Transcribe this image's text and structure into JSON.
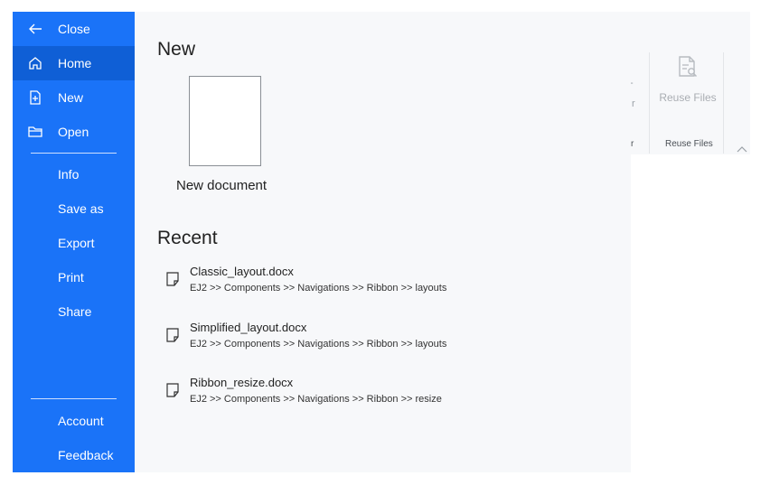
{
  "sidebar": {
    "items": [
      {
        "label": "Close",
        "icon": "arrow-left-icon"
      },
      {
        "label": "Home",
        "icon": "home-icon",
        "active": true
      },
      {
        "label": "New",
        "icon": "new-file-icon"
      },
      {
        "label": "Open",
        "icon": "folder-icon"
      },
      {
        "label": "Info"
      },
      {
        "label": "Save as"
      },
      {
        "label": "Export"
      },
      {
        "label": "Print"
      },
      {
        "label": "Share"
      },
      {
        "label": "Account"
      },
      {
        "label": "Feedback"
      }
    ]
  },
  "main": {
    "new_heading": "New",
    "new_document_label": "New document",
    "recent_heading": "Recent",
    "recent": [
      {
        "name": "Classic_layout.docx",
        "path": "EJ2 >> Components >> Navigations >> Ribbon >> layouts"
      },
      {
        "name": "Simplified_layout.docx",
        "path": "EJ2 >> Components >> Navigations >> Ribbon >> layouts"
      },
      {
        "name": "Ribbon_resize.docx",
        "path": "EJ2 >> Components >> Navigations >> Ribbon >> resize"
      }
    ]
  },
  "ribbon": {
    "reuse_files_label": "Reuse Files",
    "reuse_files_group": "Reuse Files",
    "partial_label": "r",
    "partial_group": "r",
    "partial_dash": "-"
  },
  "colors": {
    "sidebar_bg": "#1a73f8",
    "sidebar_active": "#0f5fd6",
    "content_bg": "#f7f8fa"
  }
}
